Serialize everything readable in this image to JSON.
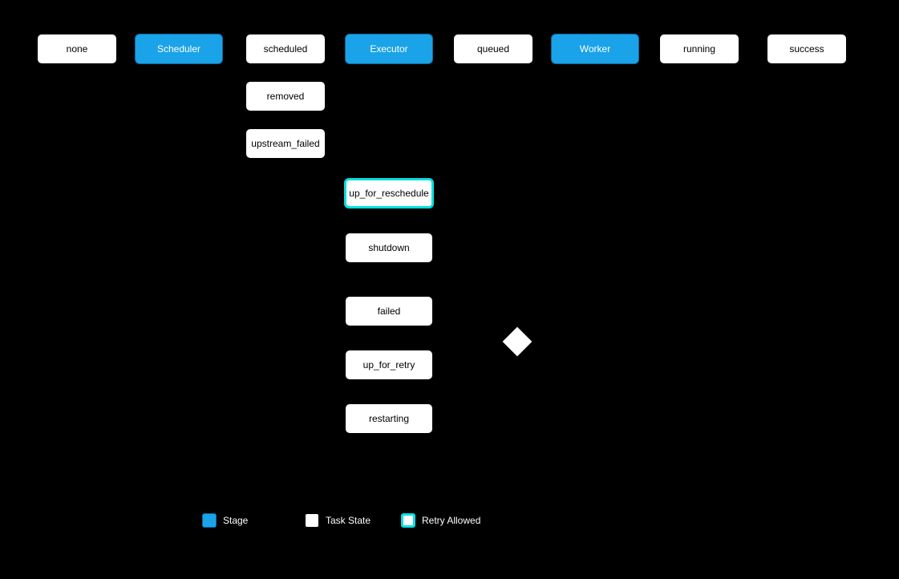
{
  "nodes": {
    "none": {
      "label": "none",
      "type": "white"
    },
    "scheduler": {
      "label": "Scheduler",
      "type": "blue"
    },
    "scheduled": {
      "label": "scheduled",
      "type": "white"
    },
    "executor": {
      "label": "Executor",
      "type": "blue"
    },
    "queued": {
      "label": "queued",
      "type": "white"
    },
    "worker": {
      "label": "Worker",
      "type": "blue"
    },
    "running": {
      "label": "running",
      "type": "white"
    },
    "success": {
      "label": "success",
      "type": "white"
    },
    "removed": {
      "label": "removed",
      "type": "white"
    },
    "upstream_failed": {
      "label": "upstream_failed",
      "type": "white"
    },
    "up_for_reschedule": {
      "label": "up_for_reschedule",
      "type": "highlight"
    },
    "shutdown": {
      "label": "shutdown",
      "type": "white"
    },
    "failed": {
      "label": "failed",
      "type": "white"
    },
    "up_for_retry": {
      "label": "up_for_retry",
      "type": "white"
    },
    "restarting": {
      "label": "restarting",
      "type": "white"
    }
  },
  "legend": {
    "stage": "Stage",
    "state": "Task State",
    "retry": "Retry Allowed"
  },
  "decision": {
    "name": "retry-decision"
  }
}
